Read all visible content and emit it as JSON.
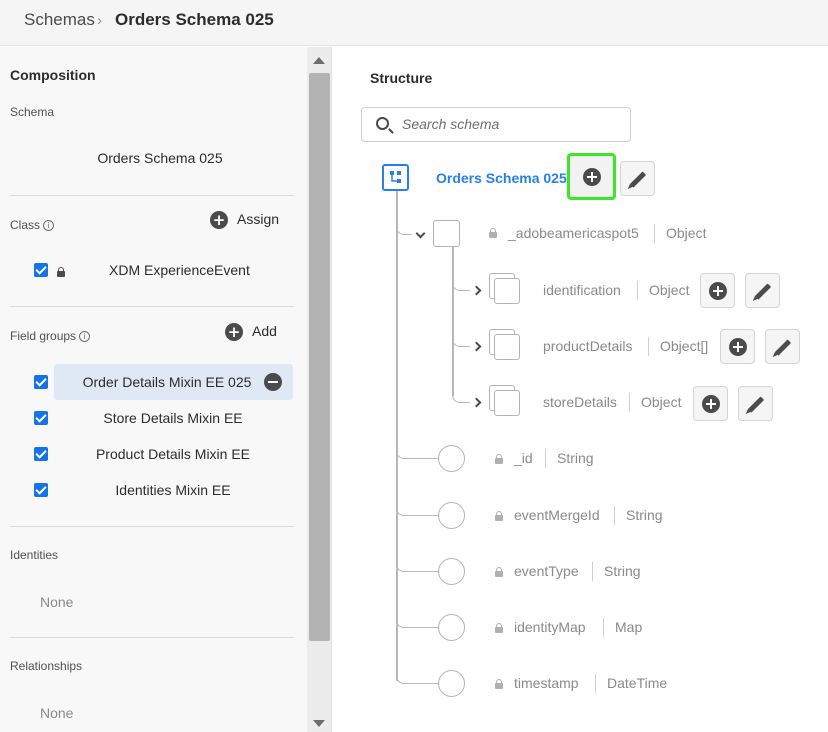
{
  "breadcrumb": {
    "root": "Schemas",
    "separator": "›",
    "current": "Orders Schema 025"
  },
  "composition": {
    "title": "Composition",
    "schema_label": "Schema",
    "schema_name": "Orders Schema 025",
    "class_label": "Class",
    "assign_label": "Assign",
    "class_name": "XDM ExperienceEvent",
    "field_groups_label": "Field groups",
    "add_label": "Add",
    "field_groups": [
      {
        "label": "Order Details Mixin EE 025",
        "checked": true,
        "selected": true
      },
      {
        "label": "Store Details Mixin EE",
        "checked": true
      },
      {
        "label": "Product Details Mixin EE",
        "checked": true
      },
      {
        "label": "Identities Mixin EE",
        "checked": true
      }
    ],
    "identities_label": "Identities",
    "identities_value": "None",
    "relationships_label": "Relationships",
    "relationships_value": "None"
  },
  "structure": {
    "title": "Structure",
    "search_placeholder": "Search schema",
    "root_name": "Orders Schema 025",
    "fields": [
      {
        "name": "_adobeamericaspot5",
        "type": "Object"
      },
      {
        "name": "identification",
        "type": "Object"
      },
      {
        "name": "productDetails",
        "type": "Object[]"
      },
      {
        "name": "storeDetails",
        "type": "Object"
      },
      {
        "name": "_id",
        "type": "String"
      },
      {
        "name": "eventMergeId",
        "type": "String"
      },
      {
        "name": "eventType",
        "type": "String"
      },
      {
        "name": "identityMap",
        "type": "Map"
      },
      {
        "name": "timestamp",
        "type": "DateTime"
      }
    ]
  },
  "colors": {
    "accent": "#2680eb",
    "highlight": "#3ee62a",
    "checkbox": "#1473e6"
  }
}
